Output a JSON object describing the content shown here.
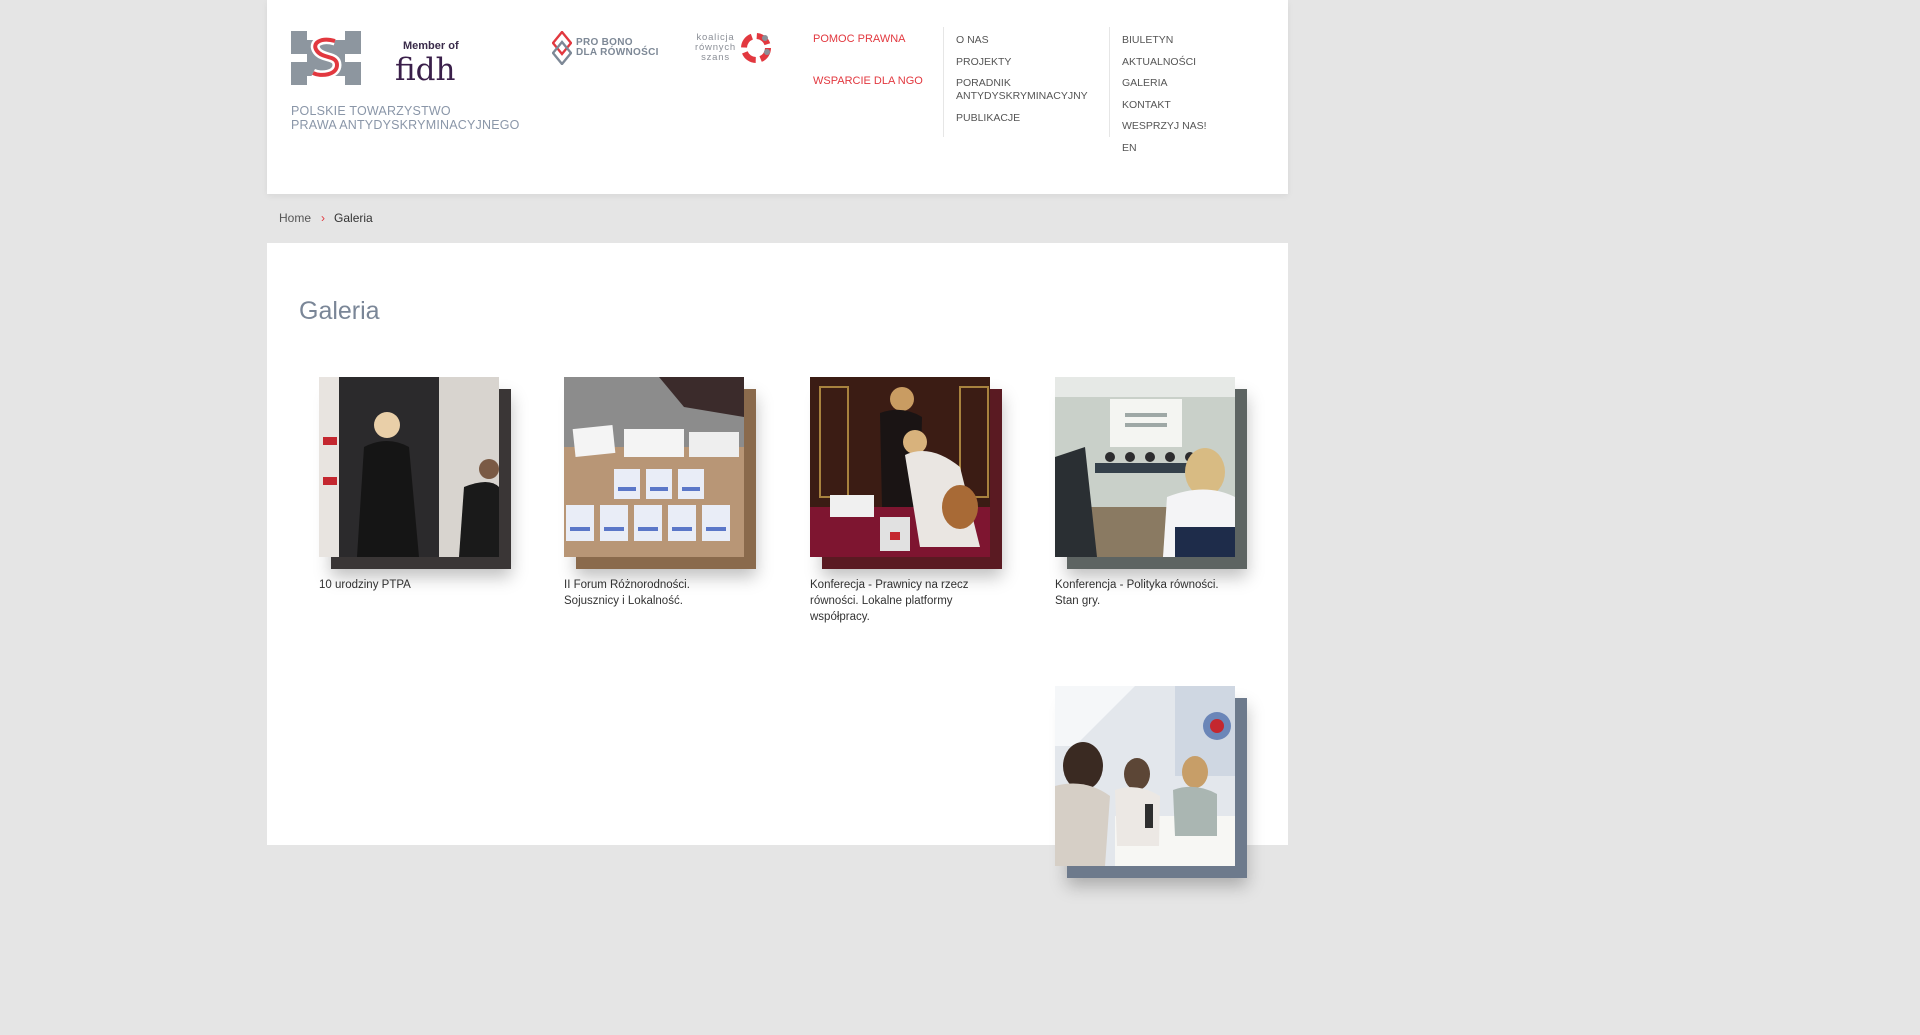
{
  "brand": {
    "member_of": "Member of",
    "fidh": "fidh",
    "org_name_line1": "POLSKIE TOWARZYSTWO",
    "org_name_line2": "PRAWA ANTYDYSKRYMINACYJNEGO",
    "probono_line1": "PRO BONO",
    "probono_line2": "DLA RÓWNOŚCI",
    "koalicja_line1": "koalicja",
    "koalicja_line2": "równych",
    "koalicja_line3": "szans"
  },
  "nav": {
    "highlight": [
      {
        "label": "POMOC PRAWNA"
      },
      {
        "label": "WSPARCIE DLA NGO"
      }
    ],
    "col1": [
      {
        "label": "O NAS"
      },
      {
        "label": "PROJEKTY"
      },
      {
        "label": "PORADNIK ANTYDYSKRYMINACYJNY"
      },
      {
        "label": "PUBLIKACJE"
      }
    ],
    "col2": [
      {
        "label": "BIULETYN"
      },
      {
        "label": "AKTUALNOŚCI"
      },
      {
        "label": "GALERIA"
      },
      {
        "label": "KONTAKT"
      },
      {
        "label": "WESPRZYJ NAS!"
      },
      {
        "label": "EN"
      }
    ]
  },
  "breadcrumb": {
    "home": "Home",
    "separator": "›",
    "current": "Galeria"
  },
  "page": {
    "title": "Galeria"
  },
  "gallery": [
    {
      "title": "10 urodziny PTPA"
    },
    {
      "title": "II Forum Różnorodności. Sojusznicy i Lokalność."
    },
    {
      "title": "Konferecja - Prawnicy na rzecz równości. Lokalne platformy współpracy."
    },
    {
      "title": "Konferencja - Polityka równości. Stan gry."
    },
    {
      "title": ""
    }
  ],
  "colors": {
    "accent_red": "#e2383f",
    "title_gray": "#7a8697",
    "background": "#e5e5e5"
  }
}
